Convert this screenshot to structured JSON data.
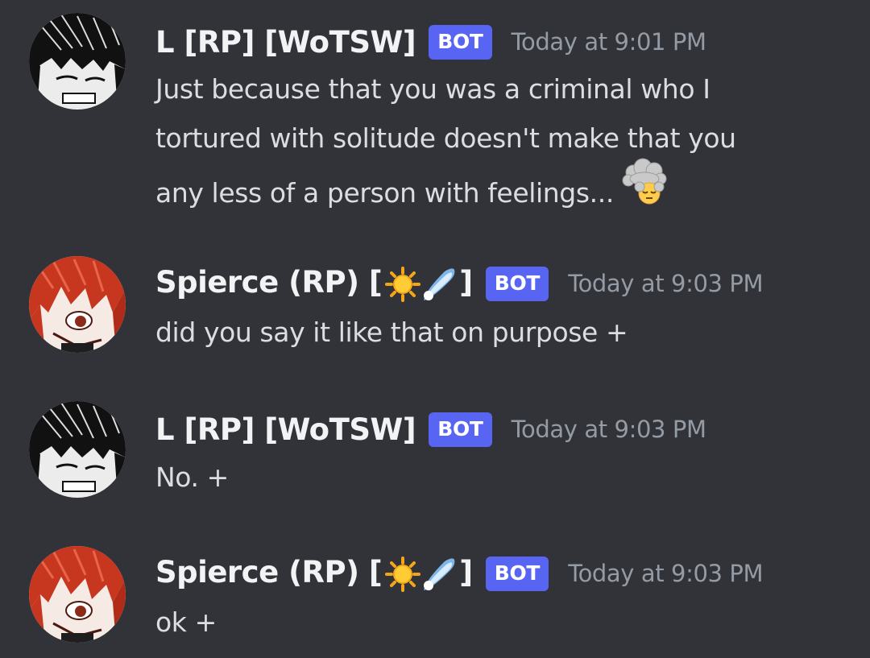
{
  "messages": [
    {
      "username": "L [RP] [WoTSW]",
      "badge": "BOT",
      "timestamp": "Today at 9:01 PM",
      "lines": [
        "Just because that you was a criminal who I",
        "tortured with solitude doesn't make that you",
        "any less of a person with feelings..."
      ],
      "trailing_emoji": "face-in-clouds-emoji",
      "avatar": "dark-haired-character-avatar"
    },
    {
      "username_prefix": "Spierce (RP) [",
      "username_suffix": "]",
      "name_emojis": [
        "sun-emoji",
        "comet-emoji"
      ],
      "badge": "BOT",
      "timestamp": "Today at 9:03 PM",
      "lines": [
        "did you say it like that on purpose +"
      ],
      "avatar": "red-haired-character-avatar"
    },
    {
      "username": "L [RP] [WoTSW]",
      "badge": "BOT",
      "timestamp": "Today at 9:03 PM",
      "lines": [
        "No. +"
      ],
      "avatar": "dark-haired-character-avatar"
    },
    {
      "username_prefix": "Spierce (RP) [",
      "username_suffix": "]",
      "name_emojis": [
        "sun-emoji",
        "comet-emoji"
      ],
      "badge": "BOT",
      "timestamp": "Today at 9:03 PM",
      "lines": [
        "ok +"
      ],
      "avatar": "red-haired-character-avatar"
    }
  ],
  "colors": {
    "background": "#313338",
    "username": "#f2f3f5",
    "text": "#dbdee1",
    "timestamp": "#949ba4",
    "bot_badge": "#5865f2"
  }
}
